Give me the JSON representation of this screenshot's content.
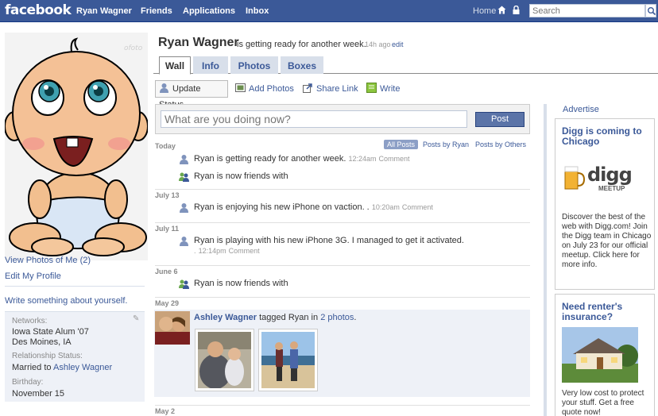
{
  "topbar": {
    "logo": "facebook",
    "nav": [
      "Ryan Wagner",
      "Friends",
      "Applications",
      "Inbox"
    ],
    "home": "Home",
    "search_placeholder": "Search"
  },
  "profile": {
    "name": "Ryan Wagner",
    "status": "is getting ready for another week.",
    "status_time": "14h ago",
    "status_edit": "edit"
  },
  "tabs": [
    "Wall",
    "Info",
    "Photos",
    "Boxes"
  ],
  "publisher": {
    "update_status": "Update Status",
    "add_photos": "Add Photos",
    "share_link": "Share Link",
    "write": "Write",
    "input_placeholder": "What are you doing now?",
    "post": "Post"
  },
  "filters": {
    "all": "All Posts",
    "by_ryan": "Posts by Ryan",
    "by_others": "Posts by Others"
  },
  "left": {
    "view_photos": "View Photos of Me (2)",
    "edit_profile": "Edit My Profile",
    "write_about": "Write something about yourself.",
    "networks_label": "Networks:",
    "network_1": "Iowa State Alum '07",
    "network_2": "Des Moines, IA",
    "relationship_label": "Relationship Status:",
    "relationship_text": "Married to",
    "relationship_partner": "Ashley Wagner",
    "birthday_label": "Birthday:",
    "birthday": "November 15"
  },
  "feed": {
    "today": "Today",
    "item1": "Ryan is getting ready for another week.",
    "item1_time": "12:24am",
    "comment": "Comment",
    "item2": "Ryan is now friends with",
    "jul13": "July 13",
    "item3": "Ryan is enjoying his new iPhone on vaction. .",
    "item3_time": "10:20am",
    "jul11": "July 11",
    "item4_line1": "Ryan is playing with his new iPhone 3G. I managed to get it activated.",
    "item4_line2": ".",
    "item4_time": "12:14pm",
    "jun6": "June 6",
    "item5": "Ryan is now friends with",
    "may29": "May 29",
    "tag_who": "Ashley Wagner",
    "tag_mid": "tagged Ryan in",
    "tag_count": "2 photos",
    "tag_end": ".",
    "may2": "May 2"
  },
  "ads": {
    "advertise": "Advertise",
    "digg_title": "Digg is coming to Chicago",
    "digg_logo": "digg",
    "digg_meetup": "MEETUP",
    "digg_body": "Discover the best of the web with Digg.com! Join the Digg team in Chicago on July 23 for our official meetup. Click here for more info.",
    "renter_title": "Need renter's insurance?",
    "renter_body": "Very low cost to protect your stuff. Get a free quote now!"
  },
  "colors": {
    "brand": "#3b5998",
    "light": "#d8dfea"
  }
}
